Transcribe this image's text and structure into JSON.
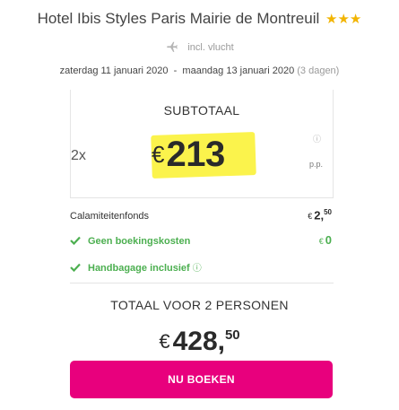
{
  "hotel": {
    "name": "Hotel Ibis Styles Paris Mairie de Montreuil",
    "stars": "★★★"
  },
  "flight": {
    "label": "incl. vlucht",
    "icon": "plane-icon"
  },
  "dates": {
    "range": "zaterdag 11 januari 2020  -  maandag 13 januari 2020",
    "nights": "(3 dagen)"
  },
  "subtotal": {
    "label": "SUBTOTAAL",
    "quantity": "2x",
    "currency": "€",
    "amount": "213",
    "info": "ⓘ",
    "per_person": "p.p."
  },
  "costs": [
    {
      "label": "Calamiteitenfonds",
      "currency": "€",
      "whole": "2,",
      "cents": "50"
    },
    {
      "label": "Geen boekingskosten",
      "currency": "€",
      "whole": "0",
      "included": true
    },
    {
      "label": "Handbagage inclusief",
      "info": "ⓘ",
      "included": true
    }
  ],
  "total": {
    "label": "TOTAAL VOOR 2 PERSONEN",
    "currency": "€",
    "whole": "428,",
    "cents": "50"
  },
  "cta": {
    "label": "NU BOEKEN"
  },
  "colors": {
    "accent": "#e8007d",
    "highlight": "#fbf34c",
    "success": "#4caf50",
    "star": "#f2b400"
  }
}
